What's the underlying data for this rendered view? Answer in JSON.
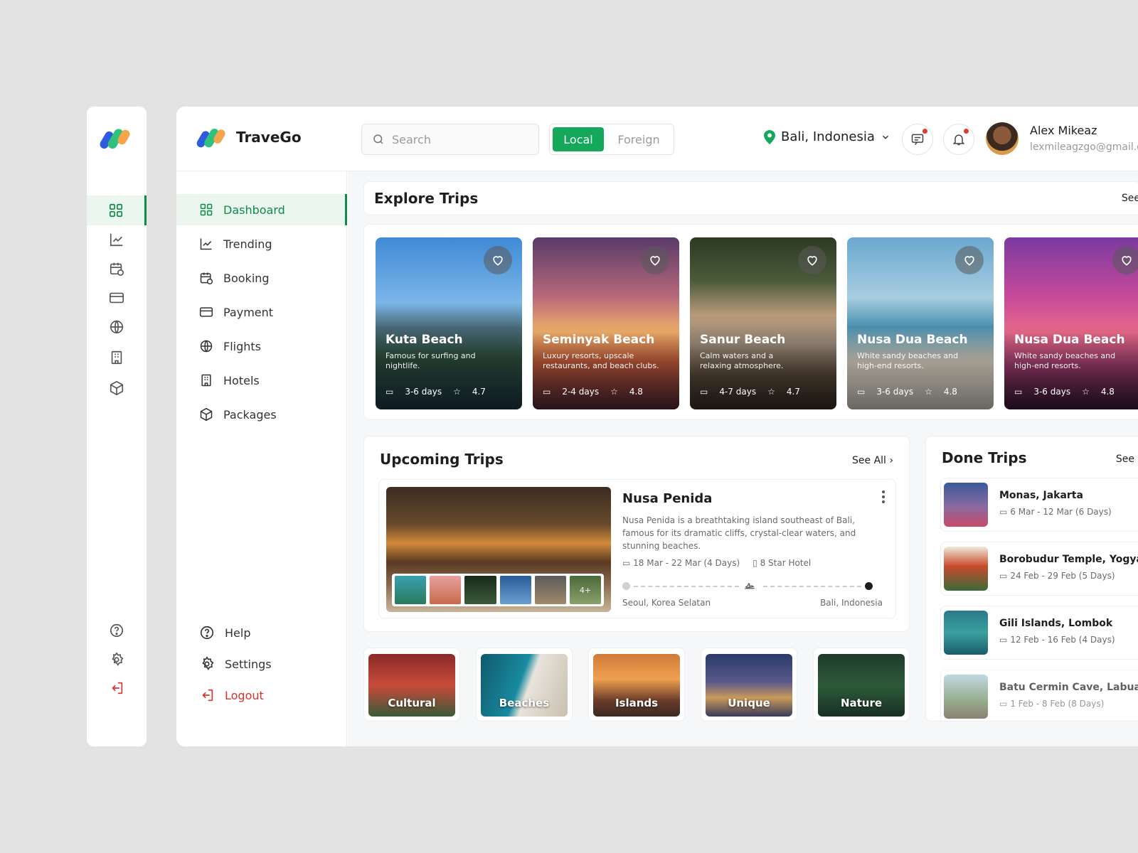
{
  "brand": {
    "name": "TraveGo"
  },
  "search": {
    "placeholder": "Search"
  },
  "toggle": {
    "local": "Local",
    "foreign": "Foreign"
  },
  "location": {
    "label": "Bali, Indonesia"
  },
  "user": {
    "name": "Alex Mikeaz",
    "email": "lexmileagzgo@gmail.co"
  },
  "nav": {
    "items": [
      {
        "label": "Dashboard"
      },
      {
        "label": "Trending"
      },
      {
        "label": "Booking"
      },
      {
        "label": "Payment"
      },
      {
        "label": "Flights"
      },
      {
        "label": "Hotels"
      },
      {
        "label": "Packages"
      }
    ],
    "help": "Help",
    "settings": "Settings",
    "logout": "Logout"
  },
  "explore": {
    "title": "Explore Trips",
    "see_all": "See",
    "trips": [
      {
        "name": "Kuta Beach",
        "desc": "Famous for surfing and nightlife.",
        "days": "3-6 days",
        "rating": "4.7"
      },
      {
        "name": "Seminyak Beach",
        "desc": "Luxury resorts, upscale restaurants, and beach clubs.",
        "days": "2-4 days",
        "rating": "4.8"
      },
      {
        "name": "Sanur Beach",
        "desc": "Calm waters and a relaxing atmosphere.",
        "days": "4-7 days",
        "rating": "4.7"
      },
      {
        "name": "Nusa Dua Beach",
        "desc": "White sandy beaches and high-end resorts.",
        "days": "3-6 days",
        "rating": "4.8"
      },
      {
        "name": "Nusa Dua Beach",
        "desc": "White sandy beaches and high-end resorts.",
        "days": "3-6 days",
        "rating": "4.8"
      }
    ]
  },
  "upcoming": {
    "title": "Upcoming Trips",
    "see_all": "See All",
    "trip": {
      "name": "Nusa Penida",
      "desc": "Nusa Penida is a breathtaking island southeast of Bali, famous for its dramatic cliffs, crystal-clear waters, and stunning beaches.",
      "dates": "18 Mar - 22 Mar (4 Days)",
      "hotel": "8 Star Hotel",
      "from": "Seoul, Korea Selatan",
      "to": "Bali, Indonesia",
      "more_photos": "4+"
    }
  },
  "categories": [
    "Cultural",
    "Beaches",
    "Islands",
    "Unique",
    "Nature"
  ],
  "done": {
    "title": "Done Trips",
    "see_all": "See",
    "trips": [
      {
        "name": "Monas, Jakarta",
        "dates": "6 Mar - 12 Mar (6 Days)"
      },
      {
        "name": "Borobudur Temple, Yogya..",
        "dates": "24 Feb - 29 Feb (5 Days)"
      },
      {
        "name": "Gili Islands, Lombok",
        "dates": "12 Feb - 16 Feb (4 Days)"
      },
      {
        "name": "Batu Cermin Cave, Labuan..",
        "dates": "1 Feb - 8 Feb (8 Days)"
      }
    ]
  },
  "colors": {
    "accent": "#14a85a",
    "accent_dark": "#0e8a4a",
    "danger": "#d8322b",
    "background": "#e3e3e3"
  }
}
